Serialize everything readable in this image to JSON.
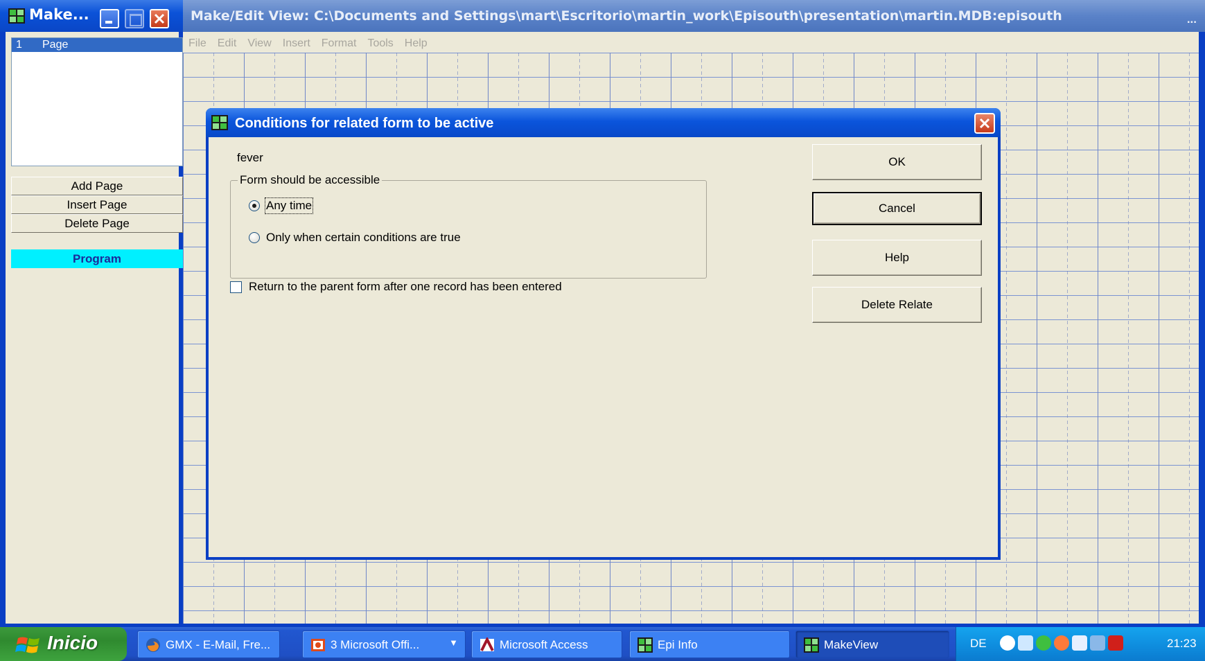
{
  "left_window": {
    "title": "Make...",
    "pages": [
      {
        "num": "1",
        "label": "Page"
      }
    ],
    "buttons": {
      "add_page": "Add Page",
      "insert_page": "Insert Page",
      "delete_page": "Delete Page",
      "program": "Program"
    }
  },
  "main_window": {
    "title": "Make/Edit View: C:\\Documents and Settings\\mart\\Escritorio\\martin_work\\Episouth\\presentation\\martin.MDB:episouth",
    "title_dots": "...",
    "menu": [
      "File",
      "Edit",
      "View",
      "Insert",
      "Format",
      "Tools",
      "Help"
    ]
  },
  "dialog": {
    "title": "Conditions for related form to be active",
    "field_name": "fever",
    "group_label": "Form should be accessible",
    "radio_any_time": "Any time",
    "radio_conditions": "Only when certain conditions are true",
    "radio_selected": "any_time",
    "return_checkbox_label": "Return to the parent form after one record has been entered",
    "return_checked": false,
    "buttons": {
      "ok": "OK",
      "cancel": "Cancel",
      "help": "Help",
      "delete_relate": "Delete Relate"
    }
  },
  "taskbar": {
    "start_label": "Inicio",
    "tasks": [
      {
        "label": "GMX - E-Mail, Fre...",
        "icon": "firefox-icon"
      },
      {
        "label": "3 Microsoft Offi...",
        "icon": "office-icon"
      },
      {
        "label": "Microsoft Access",
        "icon": "access-icon"
      },
      {
        "label": "Epi Info",
        "icon": "epiinfo-icon"
      },
      {
        "label": "MakeView",
        "icon": "makeview-icon"
      }
    ],
    "language": "DE",
    "clock": "21:23"
  },
  "colors": {
    "xp_blue": "#0a3fc4",
    "dialog_face": "#ece9d8",
    "selection": "#316ac5",
    "program_button": "#00f0ff"
  }
}
